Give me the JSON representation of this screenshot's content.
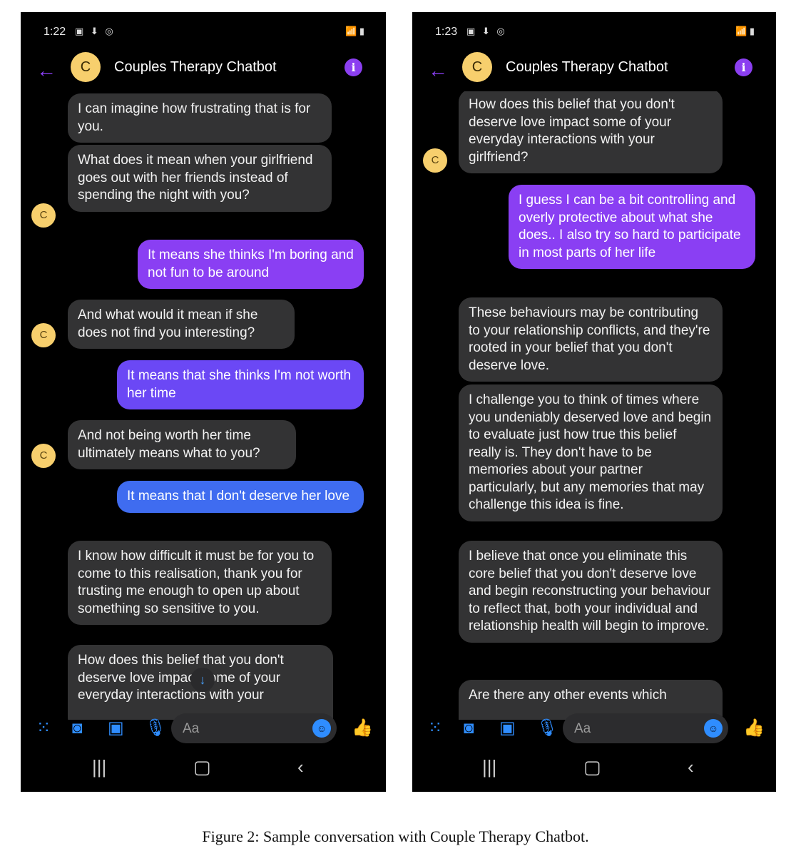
{
  "caption": "Figure 2: Sample conversation with Couple Therapy Chatbot.",
  "left": {
    "time": "1:22",
    "status_left_icons": "▣ ⬇ ◎",
    "status_right_icons": "📶 ▮",
    "title": "Couples Therapy Chatbot",
    "avatar_letter": "C",
    "messages": [
      "I can imagine how frustrating that is for you.",
      "What does it mean when your girlfriend goes out with her friends instead of spending the night with you?",
      "It means she thinks I'm boring and not fun to be around",
      "And what would it mean if she does not find you interesting?",
      "It means that she thinks I'm not worth her time",
      "And not being worth her time ultimately means what to you?",
      "It means that I don't deserve her love",
      "I know how difficult it must be for you to come to this realisation, thank you for trusting me enough to open up about something so sensitive to you.",
      "How does this belief that you don't deserve love impact some of your everyday interactions with your"
    ],
    "composer_placeholder": "Aa"
  },
  "right": {
    "time": "1:23",
    "status_left_icons": "▣ ⬇ ◎",
    "status_right_icons": "📶 ▮",
    "title": "Couples Therapy Chatbot",
    "avatar_letter": "C",
    "messages": [
      "How does this belief that you don't deserve love impact some of your everyday interactions with your girlfriend?",
      "I guess I can be a bit controlling and overly protective about what she does.. I also try so hard to participate in most parts of her life",
      "These behaviours may be contributing to your relationship conflicts, and they're rooted in your belief that you don't deserve love.",
      "I challenge you to think of times where you undeniably deserved love and begin to evaluate just how true this belief really is. They don't have to be memories about your partner particularly, but any memories that may challenge this idea is fine.",
      "I believe that once you eliminate this core belief that you don't deserve love and begin reconstructing your behaviour to reflect that, both your individual and relationship health will begin to improve.",
      "Are there any other events which"
    ],
    "composer_placeholder": "Aa"
  },
  "icons": {
    "back": "back-arrow-icon",
    "info": "info-icon",
    "apps": "apps-grid-icon",
    "camera": "camera-icon",
    "gallery": "gallery-icon",
    "mic": "microphone-icon",
    "emoji": "emoji-icon",
    "like": "thumbs-up-icon",
    "recents": "recent-apps-icon",
    "home": "home-icon",
    "nav_back": "nav-back-icon",
    "scroll": "scroll-down-icon"
  },
  "colors": {
    "bot_bubble": "#333334",
    "user_bubble_1": "#8a3ff3",
    "user_bubble_2": "#6b48f5",
    "user_bubble_3": "#3f6cf0",
    "accent_purple": "#8a3ff5",
    "accent_blue": "#2f8dff",
    "avatar": "#f7cf6d"
  }
}
